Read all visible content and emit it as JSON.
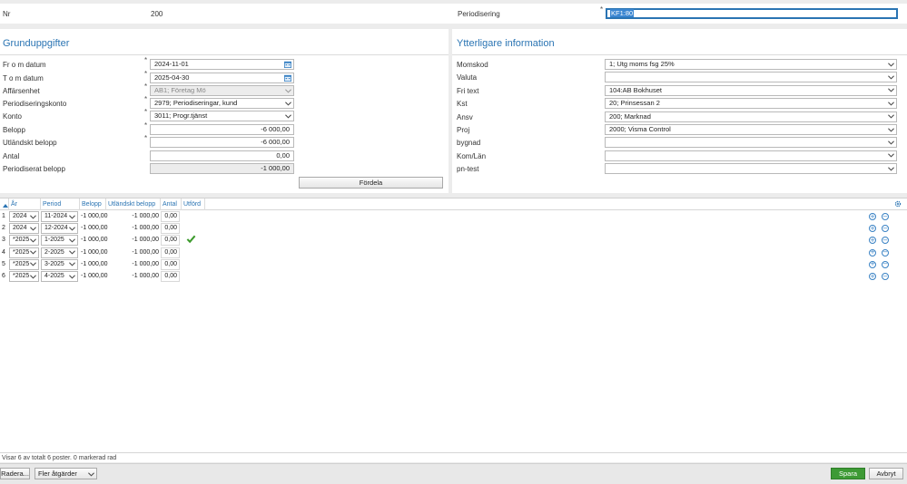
{
  "header": {
    "nr_label": "Nr",
    "nr_value": "200",
    "periodisering_label": "Periodisering",
    "periodisering_value": "KF1:80"
  },
  "grund": {
    "title": "Grunduppgifter",
    "fields": [
      {
        "label": "Fr o m datum",
        "value": "2024-11-01"
      },
      {
        "label": "T o m datum",
        "value": "2025-04-30"
      },
      {
        "label": "Affärsenhet",
        "value": "AB1; Företag Mö"
      },
      {
        "label": "Periodiseringskonto",
        "value": "2979; Periodiseringar, kund"
      },
      {
        "label": "Konto",
        "value": "3011; Progr.tjänst"
      },
      {
        "label": "Belopp",
        "value": "-6 000,00"
      },
      {
        "label": "Utländskt belopp",
        "value": "-6 000,00"
      },
      {
        "label": "Antal",
        "value": "0,00"
      },
      {
        "label": "Periodiserat belopp",
        "value": "-1 000,00"
      }
    ],
    "fordela_label": "Fördela"
  },
  "ytterligare": {
    "title": "Ytterligare information",
    "fields": [
      {
        "label": "Momskod",
        "value": "1; Utg moms fsg 25%"
      },
      {
        "label": "Valuta",
        "value": ""
      },
      {
        "label": "Fri text",
        "value": "104:AB Bokhuset"
      },
      {
        "label": "Kst",
        "value": "20; Prinsessan 2"
      },
      {
        "label": "Ansv",
        "value": "200; Marknad"
      },
      {
        "label": "Proj",
        "value": "2000; Visma Control"
      },
      {
        "label": "bygnad",
        "value": ""
      },
      {
        "label": "Kom/Län",
        "value": ""
      },
      {
        "label": "pn-test",
        "value": ""
      }
    ]
  },
  "table": {
    "columns": [
      "År",
      "Period",
      "Belopp",
      "Utländskt belopp",
      "Antal",
      "Utförd"
    ],
    "rows": [
      {
        "num": "1",
        "ar": "2024",
        "period": "11-2024",
        "belopp": "-1 000,00",
        "utl": "-1 000,00",
        "antal": "0,00",
        "utford": false
      },
      {
        "num": "2",
        "ar": "2024",
        "period": "12-2024",
        "belopp": "-1 000,00",
        "utl": "-1 000,00",
        "antal": "0,00",
        "utford": false
      },
      {
        "num": "3",
        "ar": "*2025",
        "period": "1-2025",
        "belopp": "-1 000,00",
        "utl": "-1 000,00",
        "antal": "0,00",
        "utford": true
      },
      {
        "num": "4",
        "ar": "*2025",
        "period": "2-2025",
        "belopp": "-1 000,00",
        "utl": "-1 000,00",
        "antal": "0,00",
        "utford": false
      },
      {
        "num": "5",
        "ar": "*2025",
        "period": "3-2025",
        "belopp": "-1 000,00",
        "utl": "-1 000,00",
        "antal": "0,00",
        "utford": false
      },
      {
        "num": "6",
        "ar": "*2025",
        "period": "4-2025",
        "belopp": "-1 000,00",
        "utl": "-1 000,00",
        "antal": "0,00",
        "utford": false
      }
    ],
    "status": "Visar 6 av totalt 6 poster. 0 markerad rad"
  },
  "footer": {
    "radera_label": "Radera...",
    "fler_label": "Fler åtgärder",
    "spara_label": "Spara",
    "avbryt_label": "Avbryt"
  },
  "colors": {
    "accent": "#2a74b3",
    "spara_bg": "#3d9a35",
    "check": "#3c9a2c"
  }
}
